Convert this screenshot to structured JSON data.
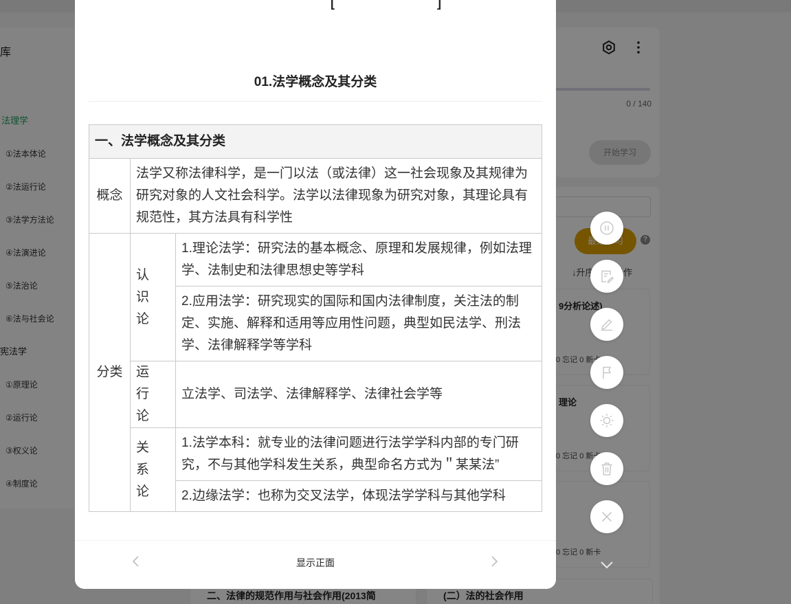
{
  "background": {
    "sidebar": {
      "library_title": "库",
      "groups": [
        {
          "label": "法理学",
          "active": true,
          "items": [
            "①法本体论",
            "②法运行论",
            "③法学方法论",
            "④法演进论",
            "⑤法治论",
            "⑥法与社会论"
          ]
        },
        {
          "label": "宪法学",
          "active": false,
          "items": [
            "①原理论",
            "②运行论",
            "③权义论",
            "④制度论"
          ]
        }
      ]
    },
    "deck_panel": {
      "progress_text": "0 / 140",
      "progress": 0,
      "start_button": "开始学习",
      "primary_button": "最近学习",
      "sort_text": "↓升序  批量操作",
      "cards": [
        {
          "title": "9分析论述)",
          "stats": "0 忘记 0  新卡"
        },
        {
          "title": "理论",
          "stats": "0 忘记 0  新卡"
        },
        {
          "title": "",
          "stats": "0 忘记 0  新卡"
        }
      ],
      "bottom_cards": [
        "二、法律的规范作用与社会作用(2013简",
        "(二）法的社会作用"
      ]
    }
  },
  "modal": {
    "top_remnant": "[ ]",
    "card_title": "01.法学概念及其分类",
    "table": {
      "header": "一、法学概念及其分类",
      "concept_label": "概念",
      "concept_text": "法学又称法律科学，是一门以法（或法律）这一社会现象及其规律为研究对象的人文社会科学。法学以法律现象为研究对象，其理论具有规范性，其方法具有科学性",
      "classify_label": "分类",
      "groups": [
        {
          "sub": "认识论",
          "items": [
            "1.理论法学：研究法的基本概念、原理和发展规律，例如法理学、法制史和法律思想史等学科",
            "2.应用法学：研究现实的国际和国内法律制度，关注法的制定、实施、解释和适用等应用性问题，典型如民法学、刑法学、法律解释学等学科"
          ]
        },
        {
          "sub": "运行论",
          "items": [
            "立法学、司法学、法律解释学、法律社会学等"
          ]
        },
        {
          "sub": "关系论",
          "items": [
            "1.法学本科：就专业的法律问题进行法学学科内部的专门研究，不与其他学科发生关系，典型命名方式为＂某某法”",
            "2.边缘法学：也称为交叉法学，体现法学学科与其他学科"
          ]
        }
      ]
    },
    "footer": {
      "show_front": "显示正面",
      "prev_icon": "chevron-left-icon",
      "next_icon": "chevron-right-icon"
    }
  },
  "floating_actions": [
    "pause-icon",
    "edit-note-icon",
    "pencil-icon",
    "flag-icon",
    "brightness-icon",
    "trash-icon",
    "close-icon"
  ],
  "colors": {
    "accent_green": "#1f9d5c",
    "accent_yellow": "#e2a400",
    "overlay": "rgba(0,0,0,0.48)"
  }
}
